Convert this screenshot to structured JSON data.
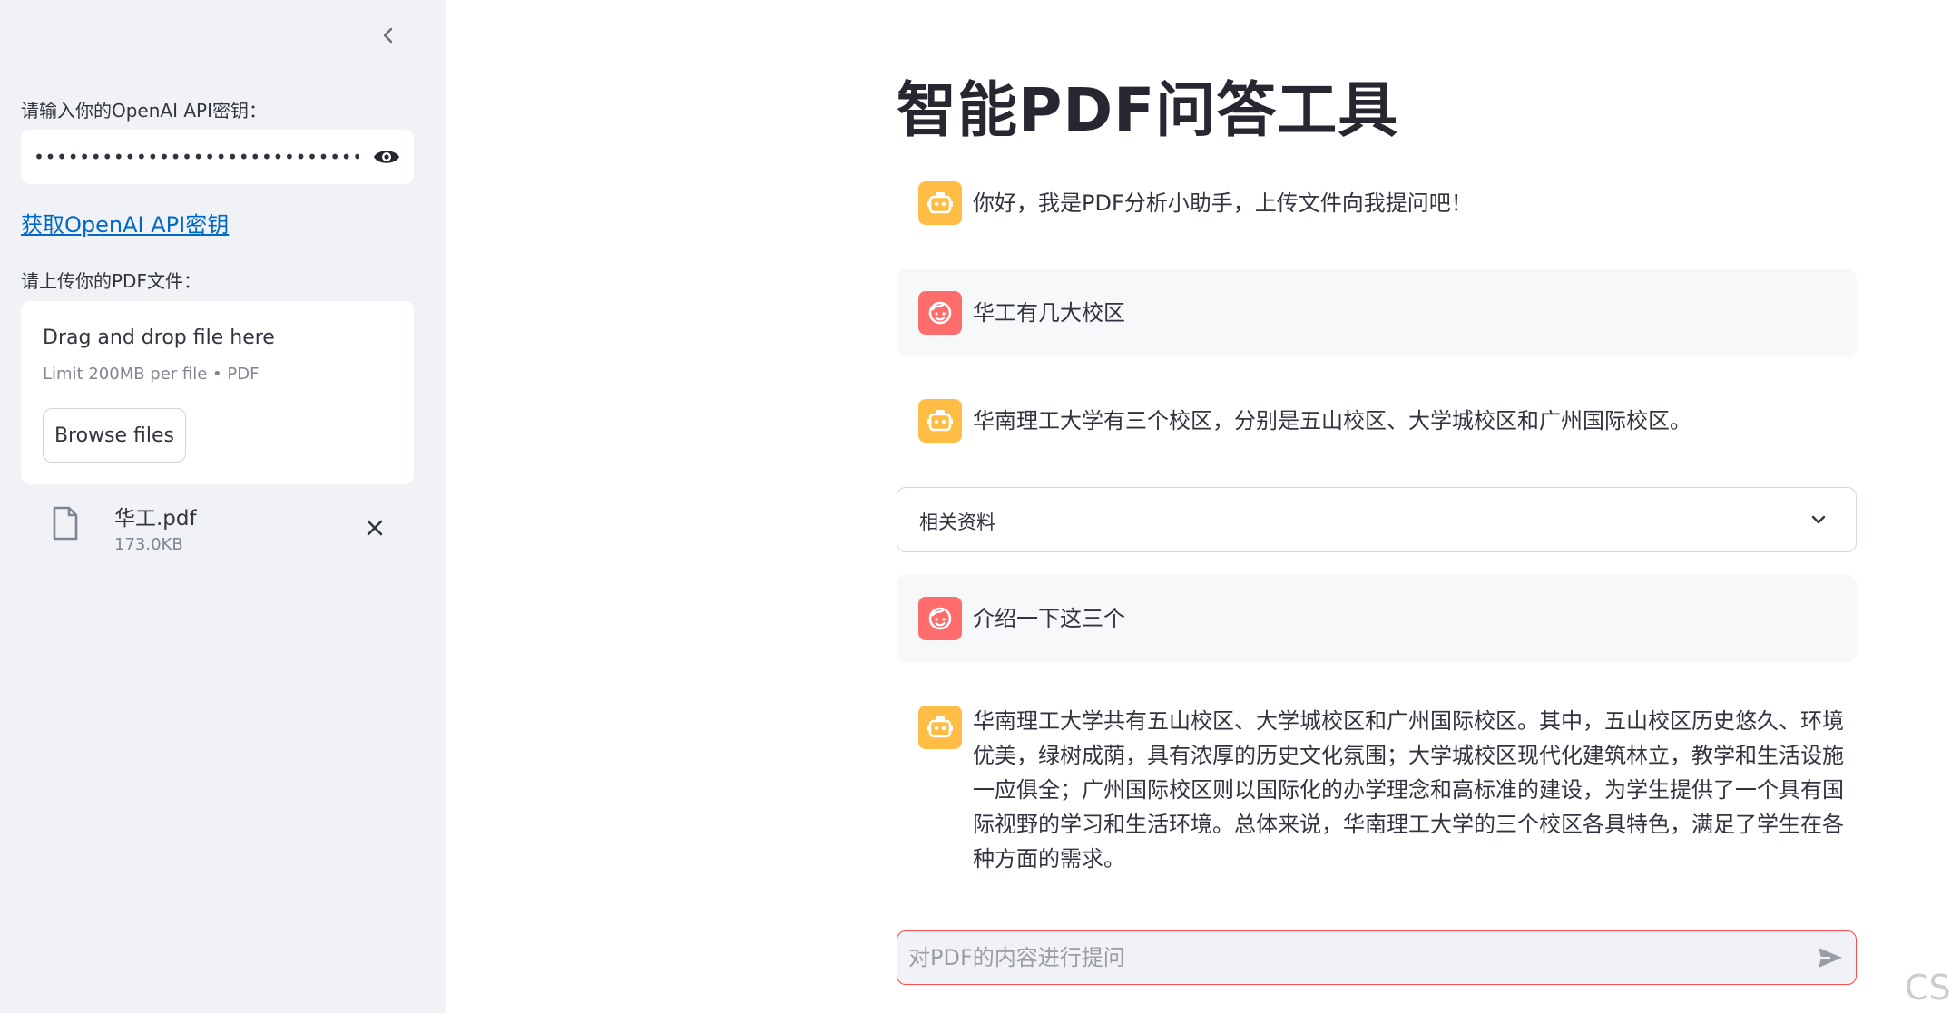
{
  "sidebar": {
    "api_key_label": "请输入你的OpenAI API密钥：",
    "api_key_value": "••••••••••••••••••••••••••••••••••••••••••••••••••••",
    "api_link_text": "获取OpenAI API密钥",
    "upload_label": "请上传你的PDF文件：",
    "uploader": {
      "title": "Drag and drop file here",
      "limit": "Limit 200MB per file • PDF",
      "browse_label": "Browse files"
    },
    "file": {
      "name": "华工.pdf",
      "size": "173.0KB"
    }
  },
  "main": {
    "title": "智能PDF问答工具",
    "messages": [
      {
        "role": "assistant",
        "text": "你好，我是PDF分析小助手，上传文件向我提问吧！"
      },
      {
        "role": "user",
        "text": "华工有几大校区"
      },
      {
        "role": "assistant",
        "text": "华南理工大学有三个校区，分别是五山校区、大学城校区和广州国际校区。"
      },
      {
        "role": "user",
        "text": "介绍一下这三个"
      },
      {
        "role": "assistant",
        "text": "华南理工大学共有五山校区、大学城校区和广州国际校区。其中，五山校区历史悠久、环境优美，绿树成荫，具有浓厚的历史文化氛围；大学城校区现代化建筑林立，教学和生活设施一应俱全；广州国际校区则以国际化的办学理念和高标准的建设，为学生提供了一个具有国际视野的学习和生活环境。总体来说，华南理工大学的三个校区各具特色，满足了学生在各种方面的需求。"
      }
    ],
    "expander_label": "相关资料",
    "chat_placeholder": "对PDF的内容进行提问"
  },
  "watermark": "CSDN @橙意满满的西瓜大侠",
  "colors": {
    "accent": "#ff4b4b",
    "bot_avatar": "#ffbd45",
    "user_avatar": "#ff6c6c",
    "link": "#0068c9"
  }
}
